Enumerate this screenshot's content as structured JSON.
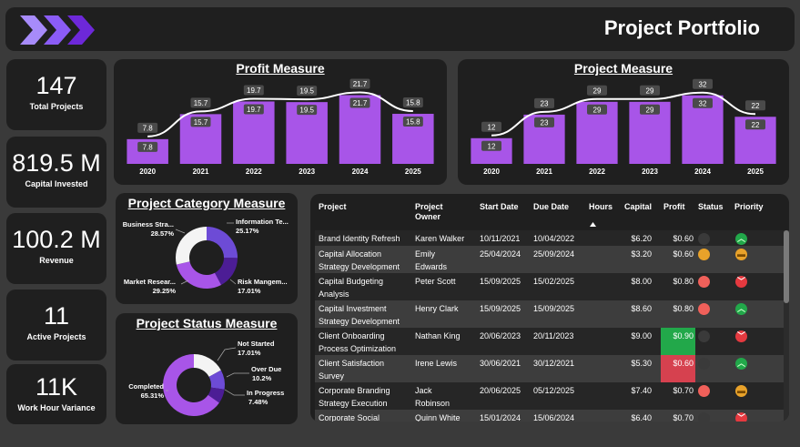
{
  "header": {
    "title": "Project Portfolio"
  },
  "kpis": [
    {
      "value": "147",
      "label": "Total Projects"
    },
    {
      "value": "819.5 M",
      "label": "Capital Invested"
    },
    {
      "value": "100.2 M",
      "label": "Revenue"
    },
    {
      "value": "11",
      "label": "Active Projects"
    },
    {
      "value": "11K",
      "label": "Work Hour Variance"
    }
  ],
  "profit": {
    "title": "Profit Measure"
  },
  "project": {
    "title": "Project Measure"
  },
  "category": {
    "title": "Project Category Measure"
  },
  "status": {
    "title": "Project Status Measure"
  },
  "colors": {
    "bar": "#a855e8",
    "donut_dark": "#4c1d95",
    "donut_mid": "#a855e8",
    "donut_light": "#6d4bd6",
    "donut_white": "#f4f4f4",
    "green": "#22a84a",
    "red": "#d6414f"
  },
  "chart_data": [
    {
      "type": "bar",
      "title": "Profit Measure",
      "categories": [
        "2020",
        "2021",
        "2022",
        "2023",
        "2024",
        "2025"
      ],
      "values": [
        7.8,
        15.7,
        19.7,
        19.5,
        21.7,
        15.8
      ],
      "ylim": [
        0,
        25
      ],
      "line_values": [
        7.8,
        15.7,
        19.7,
        19.5,
        21.7,
        15.8
      ]
    },
    {
      "type": "bar",
      "title": "Project Measure",
      "categories": [
        "2020",
        "2021",
        "2022",
        "2023",
        "2024",
        "2025"
      ],
      "values": [
        12,
        23,
        29,
        29,
        32,
        22
      ],
      "ylim": [
        0,
        37
      ],
      "line_values": [
        12,
        23,
        29,
        29,
        32,
        22
      ]
    },
    {
      "type": "pie",
      "title": "Project Category Measure",
      "slices": [
        {
          "name": "Information Te...",
          "value": 25.17,
          "label": "Information Te...",
          "pct": "25.17%"
        },
        {
          "name": "Risk Mangem...",
          "value": 17.01,
          "label": "Risk Mangem...",
          "pct": "17.01%"
        },
        {
          "name": "Market Resear...",
          "value": 29.25,
          "label": "Market Resear...",
          "pct": "29.25%"
        },
        {
          "name": "Business Stra...",
          "value": 28.57,
          "label": "Business Stra...",
          "pct": "28.57%"
        }
      ]
    },
    {
      "type": "pie",
      "title": "Project Status Measure",
      "slices": [
        {
          "name": "Not Started",
          "value": 17.01,
          "label": "Not Started",
          "pct": "17.01%"
        },
        {
          "name": "Over Due",
          "value": 10.2,
          "label": "Over Due",
          "pct": "10.2%"
        },
        {
          "name": "In Progress",
          "value": 7.48,
          "label": "In Progress",
          "pct": "7.48%"
        },
        {
          "name": "Completed",
          "value": 65.31,
          "label": "Completed",
          "pct": "65.31%"
        }
      ]
    }
  ],
  "table": {
    "columns": [
      "Project",
      "Project Owner",
      "Start Date",
      "Due Date",
      "Hours",
      "Capital",
      "Profit",
      "Status",
      "Priority"
    ],
    "rows": [
      {
        "project": [
          "Brand Identity Refresh"
        ],
        "owner": [
          "Karen Walker"
        ],
        "start": "10/11/2021",
        "due": "10/04/2022",
        "capital": "$6.20",
        "profit": "$0.60",
        "profit_hl": "",
        "status": "none",
        "priority": "high"
      },
      {
        "project": [
          "Capital Allocation",
          "Strategy Development"
        ],
        "owner": [
          "Emily",
          "Edwards"
        ],
        "start": "25/04/2024",
        "due": "25/09/2024",
        "capital": "$3.20",
        "profit": "$0.60",
        "profit_hl": "",
        "status": "amber",
        "priority": "medium"
      },
      {
        "project": [
          "Capital Budgeting",
          "Analysis"
        ],
        "owner": [
          "Peter Scott"
        ],
        "start": "15/09/2025",
        "due": "15/02/2025",
        "capital": "$8.00",
        "profit": "$0.80",
        "profit_hl": "",
        "status": "red",
        "priority": "low"
      },
      {
        "project": [
          "Capital Investment",
          "Strategy Development"
        ],
        "owner": [
          "Henry Clark"
        ],
        "start": "15/09/2025",
        "due": "15/09/2025",
        "capital": "$8.60",
        "profit": "$0.80",
        "profit_hl": "",
        "status": "red",
        "priority": "high"
      },
      {
        "project": [
          "Client Onboarding",
          "Process Optimization"
        ],
        "owner": [
          "Nathan King"
        ],
        "start": "20/06/2023",
        "due": "20/11/2023",
        "capital": "$9.00",
        "profit": "$0.90",
        "profit_hl": "green",
        "status": "none",
        "priority": "low"
      },
      {
        "project": [
          "Client Satisfaction",
          "Survey"
        ],
        "owner": [
          "Irene Lewis"
        ],
        "start": "30/06/2021",
        "due": "30/12/2021",
        "capital": "$5.30",
        "profit": "$0.60",
        "profit_hl": "red",
        "status": "none",
        "priority": "high"
      },
      {
        "project": [
          "Corporate Branding",
          "Strategy Execution"
        ],
        "owner": [
          "Jack",
          "Robinson"
        ],
        "start": "20/06/2025",
        "due": "05/12/2025",
        "capital": "$7.40",
        "profit": "$0.70",
        "profit_hl": "",
        "status": "red",
        "priority": "medium"
      },
      {
        "project": [
          "Corporate Social"
        ],
        "owner": [
          "Quinn White"
        ],
        "start": "15/01/2024",
        "due": "15/06/2024",
        "capital": "$6.40",
        "profit": "$0.70",
        "profit_hl": "",
        "status": "none",
        "priority": "low"
      }
    ]
  }
}
